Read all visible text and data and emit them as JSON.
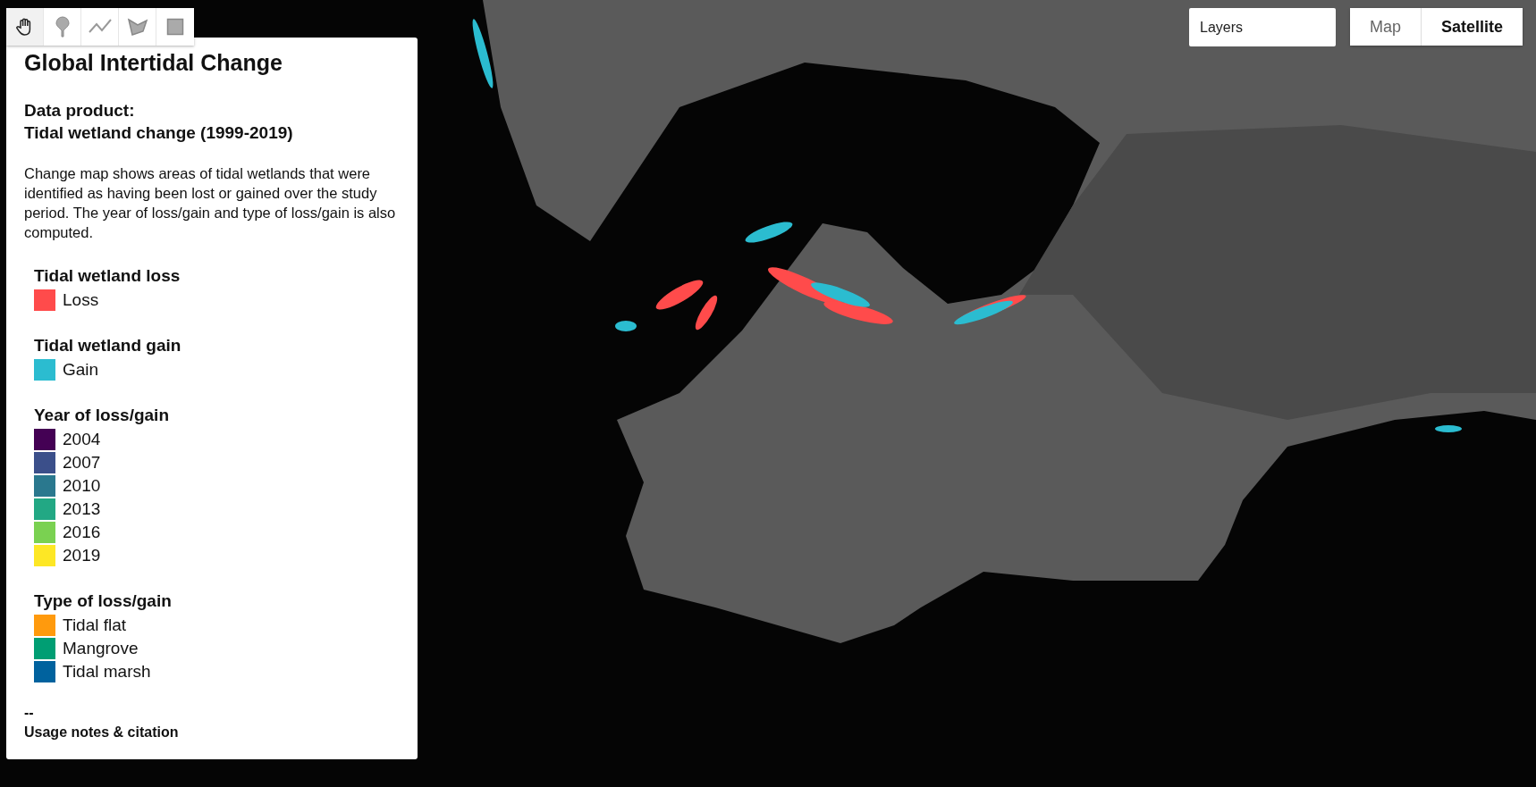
{
  "drawing_tools": [
    {
      "kind": "hand",
      "selected": true
    },
    {
      "kind": "marker",
      "selected": false
    },
    {
      "kind": "line",
      "selected": false
    },
    {
      "kind": "polygon",
      "selected": false
    },
    {
      "kind": "rectangle",
      "selected": false
    }
  ],
  "panel": {
    "title": "Global Intertidal Change",
    "subtitle_lines": [
      "Data product:",
      "Tidal wetland change (1999-2019)"
    ],
    "description": "Change map shows areas of tidal wetlands that were identified as having been lost or gained over the study period. The year of loss/gain and type of loss/gain is also computed.",
    "legend": [
      {
        "title": "Tidal wetland loss",
        "items": [
          {
            "label": "Loss",
            "color": "#ff4b4b"
          }
        ]
      },
      {
        "title": "Tidal wetland gain",
        "items": [
          {
            "label": "Gain",
            "color": "#2bbcd0"
          }
        ]
      },
      {
        "title": "Year of loss/gain",
        "items": [
          {
            "label": "2004",
            "color": "#440154"
          },
          {
            "label": "2007",
            "color": "#3b4f8a"
          },
          {
            "label": "2010",
            "color": "#2a788e"
          },
          {
            "label": "2013",
            "color": "#22a884"
          },
          {
            "label": "2016",
            "color": "#7ad151"
          },
          {
            "label": "2019",
            "color": "#fde725"
          }
        ]
      },
      {
        "title": "Type of loss/gain",
        "items": [
          {
            "label": "Tidal flat",
            "color": "#ff9a0d"
          },
          {
            "label": "Mangrove",
            "color": "#009e73"
          },
          {
            "label": "Tidal marsh",
            "color": "#00629e"
          }
        ]
      }
    ],
    "separator": "--",
    "link": "Usage notes & citation"
  },
  "layers_button": {
    "label": "Layers"
  },
  "map_types": [
    {
      "label": "Map",
      "selected": false
    },
    {
      "label": "Satellite",
      "selected": true
    }
  ]
}
